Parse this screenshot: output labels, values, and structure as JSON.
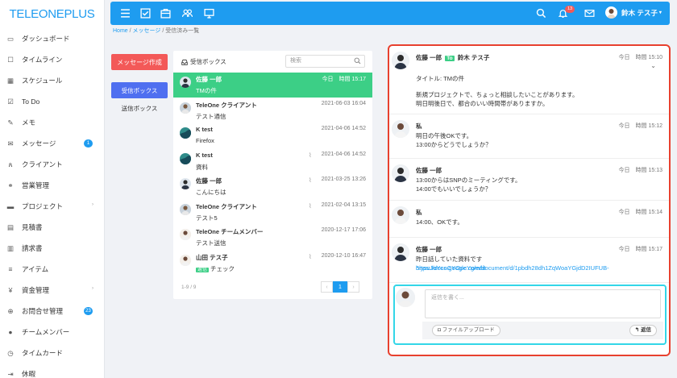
{
  "app": {
    "logo": "TELEONEPLUS"
  },
  "sidebar": {
    "items": [
      {
        "label": "ダッシュボード",
        "icon": "monitor-icon"
      },
      {
        "label": "タイムライン",
        "icon": "square-icon"
      },
      {
        "label": "スケジュール",
        "icon": "calendar-icon"
      },
      {
        "label": "To Do",
        "icon": "checkbox-icon"
      },
      {
        "label": "メモ",
        "icon": "edit-icon"
      },
      {
        "label": "メッセージ",
        "icon": "envelope-icon",
        "badge": "1"
      },
      {
        "label": "クライアント",
        "icon": "users-icon"
      },
      {
        "label": "営業管理",
        "icon": "handshake-icon"
      },
      {
        "label": "プロジェクト",
        "icon": "folder-icon",
        "caret": "›"
      },
      {
        "label": "見積書",
        "icon": "file-icon"
      },
      {
        "label": "請求書",
        "icon": "invoice-icon"
      },
      {
        "label": "アイテム",
        "icon": "list-icon"
      },
      {
        "label": "資金管理",
        "icon": "yen-icon",
        "caret": "›"
      },
      {
        "label": "お問合せ管理",
        "icon": "support-icon",
        "badge": "23"
      },
      {
        "label": "チームメンバー",
        "icon": "user-icon"
      },
      {
        "label": "タイムカード",
        "icon": "clock-icon"
      },
      {
        "label": "休暇",
        "icon": "logout-icon"
      }
    ]
  },
  "topbar": {
    "notification_count": "13",
    "user_name": "鈴木 テス子"
  },
  "breadcrumb": {
    "home": "Home",
    "sep": "/",
    "messages": "メッセージ",
    "current": "受信済み一覧"
  },
  "compose_label": "メッセージ作成",
  "tabs": {
    "inbox": "受信ボックス",
    "sent": "送信ボックス"
  },
  "list": {
    "title": "受信ボックス",
    "search_placeholder": "検索",
    "rows": [
      {
        "sender": "佐藤 一郎",
        "date": "今日　時間 15:17",
        "subject": "TMの件",
        "active": true,
        "clip": false,
        "tag": ""
      },
      {
        "sender": "TeleOne クライアント",
        "date": "2021-06-03 16:04",
        "subject": "テスト通信",
        "active": false,
        "clip": false,
        "tag": ""
      },
      {
        "sender": "K test",
        "date": "2021-04-06 14:52",
        "subject": "Firefox",
        "active": false,
        "clip": false,
        "tag": ""
      },
      {
        "sender": "K test",
        "date": "2021-04-06 14:52",
        "subject": "資料",
        "active": false,
        "clip": true,
        "tag": ""
      },
      {
        "sender": "佐藤 一郎",
        "date": "2021-03-25 13:26",
        "subject": "こんにちは",
        "active": false,
        "clip": true,
        "tag": ""
      },
      {
        "sender": "TeleOne クライアント",
        "date": "2021-02-04 13:15",
        "subject": "テスト5",
        "active": false,
        "clip": true,
        "tag": ""
      },
      {
        "sender": "TeleOne チームメンバー",
        "date": "2020-12-17 17:06",
        "subject": "テスト送信",
        "active": false,
        "clip": false,
        "tag": ""
      },
      {
        "sender": "山田 テス子",
        "date": "2020-12-10 16:47",
        "subject": "チェック",
        "active": false,
        "clip": true,
        "tag": "返信"
      }
    ],
    "pagination_text": "1-9 / 9",
    "pages": [
      "‹",
      "1",
      "›"
    ]
  },
  "thread": {
    "first": {
      "from": "佐藤 一郎",
      "to_tag": "To",
      "to": "鈴木 テス子",
      "time": "今日　時間 15:10",
      "title": "タイトル: TMの件",
      "line1": "新規プロジェクトで、ちょっと相談したいことがあります。",
      "line2": "明日明後日で、都合のいい時間帯がありますか。"
    },
    "messages": [
      {
        "name": "私",
        "time": "今日　時間 15:12",
        "line1": "明日の午後OKです。",
        "line2": "13:00からどうでしょうか？"
      },
      {
        "name": "佐藤 一郎",
        "time": "今日　時間 15:13",
        "line1": "13:00からはSNPのミーティングです。",
        "line2": "14:00でもいいでしょうか？"
      },
      {
        "name": "私",
        "time": "今日　時間 15:14",
        "line1": "14:00、OKです。",
        "line2": ""
      },
      {
        "name": "佐藤 一郎",
        "time": "今日　時間 15:17",
        "line1": "昨日話していた資料です",
        "link": "https://docs.google.com/document/d/1pbdh28dh1ZqWoaYGjdD2IUFUB-",
        "line2": "5iysuJoYnoCYOpcYg/edit"
      }
    ],
    "reply_placeholder": "返信を書く...",
    "upload_label": "ファイルアップロード",
    "send_label": "返信"
  }
}
